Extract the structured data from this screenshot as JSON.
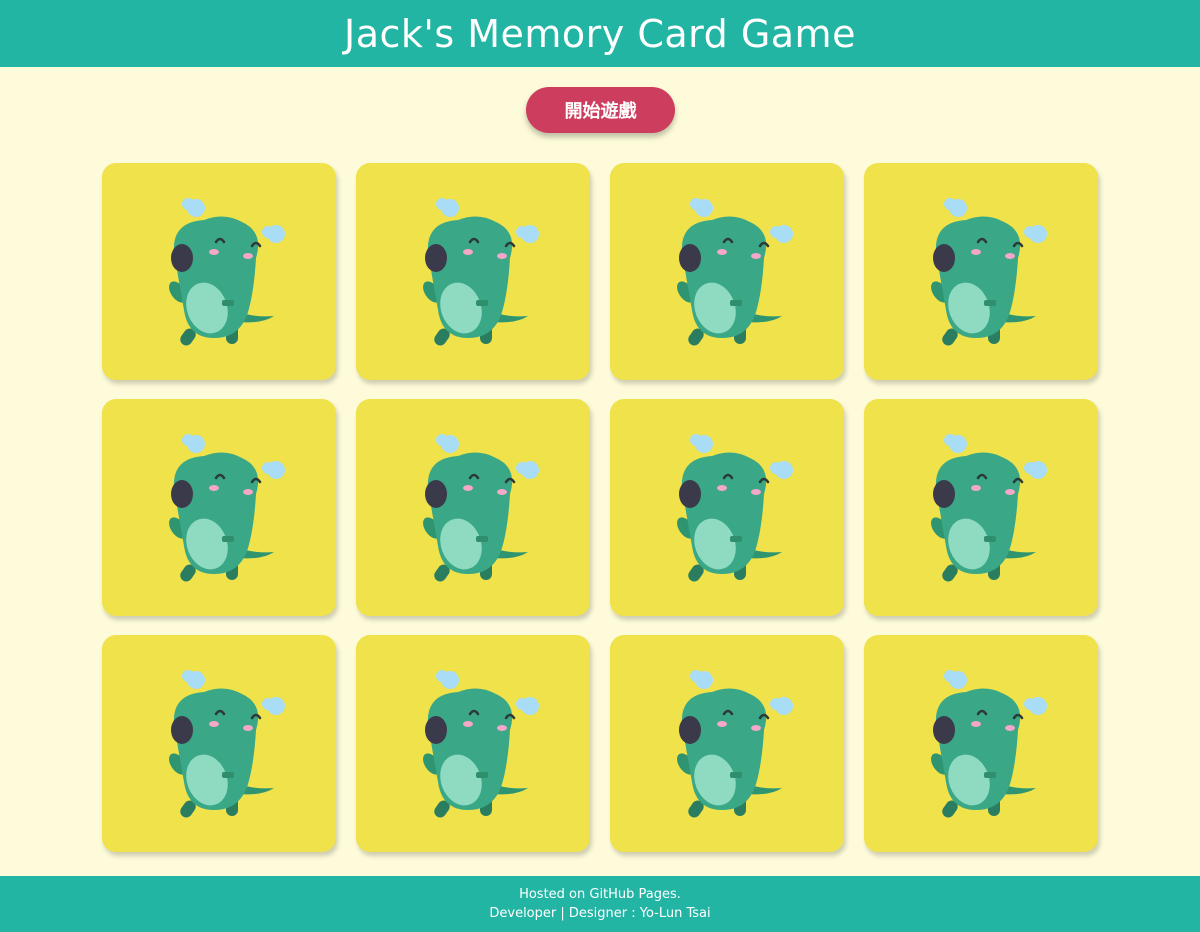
{
  "header": {
    "title": "Jack's Memory Card Game"
  },
  "controls": {
    "start_label": "開始遊戲"
  },
  "board": {
    "rows": 3,
    "columns": 4,
    "card_back_icon": "dinosaur-icon",
    "cards": [
      {
        "state": "face-down"
      },
      {
        "state": "face-down"
      },
      {
        "state": "face-down"
      },
      {
        "state": "face-down"
      },
      {
        "state": "face-down"
      },
      {
        "state": "face-down"
      },
      {
        "state": "face-down"
      },
      {
        "state": "face-down"
      },
      {
        "state": "face-down"
      },
      {
        "state": "face-down"
      },
      {
        "state": "face-down"
      },
      {
        "state": "face-down"
      }
    ]
  },
  "footer": {
    "hosted": "Hosted on GitHub Pages.",
    "credits": "Developer | Designer : Yo-Lun Tsai"
  },
  "colors": {
    "header_bg": "#23b5a4",
    "page_bg": "#fdfbd9",
    "card_back": "#f0e24b",
    "start_button": "#cd3d5e",
    "dino_body": "#3aa786",
    "dino_belly": "#8fdbc2",
    "drops": "#a9dcf5"
  }
}
